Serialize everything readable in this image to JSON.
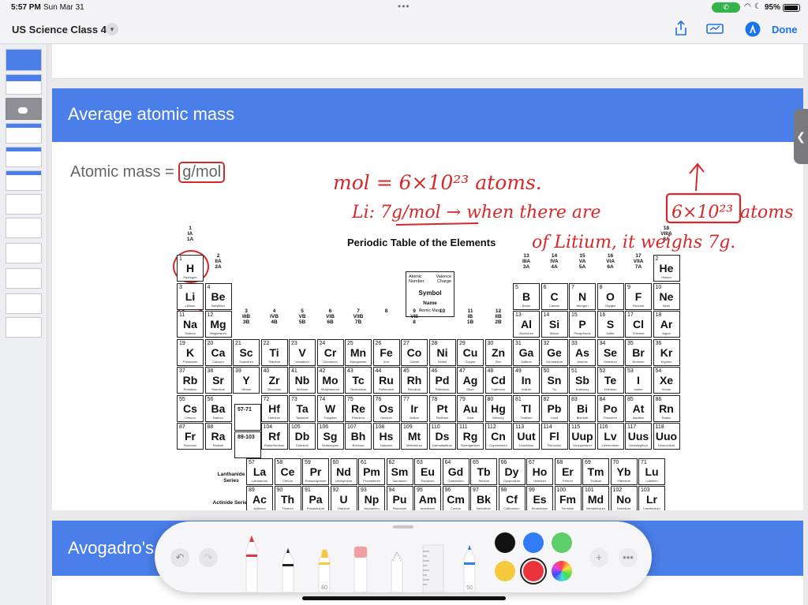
{
  "status": {
    "time": "5:57 PM",
    "date": "Sun Mar 31",
    "battery": "95%"
  },
  "toolbar": {
    "doc_title": "US Science Class 4",
    "done_label": "Done",
    "icons": [
      "share-icon",
      "slideshow-icon",
      "markup-pen-icon"
    ]
  },
  "slide": {
    "title": "Average atomic mass",
    "subtitle_prefix": "Atomic mass = ",
    "subtitle_unit": "g/mol",
    "handwriting": {
      "line1": "mol = 6×10²³ atoms.",
      "line2a": "Li: 7g/mol → when there are",
      "line2b": "6×10²³",
      "line2c": "atoms",
      "line3": "of Litium, it weighs 7g."
    }
  },
  "slide2": {
    "title": "Avogadro's"
  },
  "ptable": {
    "title": "Periodic Table of the Elements",
    "legend": {
      "atomic_number": "Atomic Number",
      "valence": "Valence Charge",
      "symbol": "Symbol",
      "name": "Name",
      "mass": "Atomic   Mass"
    },
    "lanthanide_label": "Lanthanide Series",
    "actinide_label": "Actinide Series",
    "ph_57_71": "57-71",
    "ph_89_103": "89-103",
    "groups": [
      "1 IA 1A",
      "2 IIA 2A",
      "3 IIIB 3B",
      "4 IVB 4B",
      "5 VB 5B",
      "6 VIB 6B",
      "7 VIIB 7B",
      "8",
      "9 VIII 8",
      "10",
      "11 IB 1B",
      "12 IIB 2B",
      "13 IIIA 3A",
      "14 IVA 4A",
      "15 VA 5A",
      "16 VIA 6A",
      "17 VIIA 7A",
      "18 VIIIA 8A"
    ],
    "elements": [
      {
        "n": 1,
        "s": "H",
        "name": "Hydrogen",
        "r": 0,
        "c": 0
      },
      {
        "n": 2,
        "s": "He",
        "name": "Helium",
        "r": 0,
        "c": 17
      },
      {
        "n": 3,
        "s": "Li",
        "name": "Lithium",
        "r": 1,
        "c": 0
      },
      {
        "n": 4,
        "s": "Be",
        "name": "Beryllium",
        "r": 1,
        "c": 1
      },
      {
        "n": 5,
        "s": "B",
        "name": "Boron",
        "r": 1,
        "c": 12
      },
      {
        "n": 6,
        "s": "C",
        "name": "Carbon",
        "r": 1,
        "c": 13
      },
      {
        "n": 7,
        "s": "N",
        "name": "Nitrogen",
        "r": 1,
        "c": 14
      },
      {
        "n": 8,
        "s": "O",
        "name": "Oxygen",
        "r": 1,
        "c": 15
      },
      {
        "n": 9,
        "s": "F",
        "name": "Fluorine",
        "r": 1,
        "c": 16
      },
      {
        "n": 10,
        "s": "Ne",
        "name": "Neon",
        "r": 1,
        "c": 17
      },
      {
        "n": 11,
        "s": "Na",
        "name": "Sodium",
        "r": 2,
        "c": 0
      },
      {
        "n": 12,
        "s": "Mg",
        "name": "Magnesium",
        "r": 2,
        "c": 1
      },
      {
        "n": 13,
        "s": "Al",
        "name": "Aluminum",
        "r": 2,
        "c": 12
      },
      {
        "n": 14,
        "s": "Si",
        "name": "Silicon",
        "r": 2,
        "c": 13
      },
      {
        "n": 15,
        "s": "P",
        "name": "Phosphorus",
        "r": 2,
        "c": 14
      },
      {
        "n": 16,
        "s": "S",
        "name": "Sulfur",
        "r": 2,
        "c": 15
      },
      {
        "n": 17,
        "s": "Cl",
        "name": "Chlorine",
        "r": 2,
        "c": 16
      },
      {
        "n": 18,
        "s": "Ar",
        "name": "Argon",
        "r": 2,
        "c": 17
      },
      {
        "n": 19,
        "s": "K",
        "name": "Potassium",
        "r": 3,
        "c": 0
      },
      {
        "n": 20,
        "s": "Ca",
        "name": "Calcium",
        "r": 3,
        "c": 1
      },
      {
        "n": 21,
        "s": "Sc",
        "name": "Scandium",
        "r": 3,
        "c": 2
      },
      {
        "n": 22,
        "s": "Ti",
        "name": "Titanium",
        "r": 3,
        "c": 3
      },
      {
        "n": 23,
        "s": "V",
        "name": "Vanadium",
        "r": 3,
        "c": 4
      },
      {
        "n": 24,
        "s": "Cr",
        "name": "Chromium",
        "r": 3,
        "c": 5
      },
      {
        "n": 25,
        "s": "Mn",
        "name": "Manganese",
        "r": 3,
        "c": 6
      },
      {
        "n": 26,
        "s": "Fe",
        "name": "Iron",
        "r": 3,
        "c": 7
      },
      {
        "n": 27,
        "s": "Co",
        "name": "Cobalt",
        "r": 3,
        "c": 8
      },
      {
        "n": 28,
        "s": "Ni",
        "name": "Nickel",
        "r": 3,
        "c": 9
      },
      {
        "n": 29,
        "s": "Cu",
        "name": "Copper",
        "r": 3,
        "c": 10
      },
      {
        "n": 30,
        "s": "Zn",
        "name": "Zinc",
        "r": 3,
        "c": 11
      },
      {
        "n": 31,
        "s": "Ga",
        "name": "Gallium",
        "r": 3,
        "c": 12
      },
      {
        "n": 32,
        "s": "Ge",
        "name": "Germanium",
        "r": 3,
        "c": 13
      },
      {
        "n": 33,
        "s": "As",
        "name": "Arsenic",
        "r": 3,
        "c": 14
      },
      {
        "n": 34,
        "s": "Se",
        "name": "Selenium",
        "r": 3,
        "c": 15
      },
      {
        "n": 35,
        "s": "Br",
        "name": "Bromine",
        "r": 3,
        "c": 16
      },
      {
        "n": 36,
        "s": "Kr",
        "name": "Krypton",
        "r": 3,
        "c": 17
      },
      {
        "n": 37,
        "s": "Rb",
        "name": "Rubidium",
        "r": 4,
        "c": 0
      },
      {
        "n": 38,
        "s": "Sr",
        "name": "Strontium",
        "r": 4,
        "c": 1
      },
      {
        "n": 39,
        "s": "Y",
        "name": "Yttrium",
        "r": 4,
        "c": 2
      },
      {
        "n": 40,
        "s": "Zr",
        "name": "Zirconium",
        "r": 4,
        "c": 3
      },
      {
        "n": 41,
        "s": "Nb",
        "name": "Niobium",
        "r": 4,
        "c": 4
      },
      {
        "n": 42,
        "s": "Mo",
        "name": "Molybdenum",
        "r": 4,
        "c": 5
      },
      {
        "n": 43,
        "s": "Tc",
        "name": "Technetium",
        "r": 4,
        "c": 6
      },
      {
        "n": 44,
        "s": "Ru",
        "name": "Ruthenium",
        "r": 4,
        "c": 7
      },
      {
        "n": 45,
        "s": "Rh",
        "name": "Rhodium",
        "r": 4,
        "c": 8
      },
      {
        "n": 46,
        "s": "Pd",
        "name": "Palladium",
        "r": 4,
        "c": 9
      },
      {
        "n": 47,
        "s": "Ag",
        "name": "Silver",
        "r": 4,
        "c": 10
      },
      {
        "n": 48,
        "s": "Cd",
        "name": "Cadmium",
        "r": 4,
        "c": 11
      },
      {
        "n": 49,
        "s": "In",
        "name": "Indium",
        "r": 4,
        "c": 12
      },
      {
        "n": 50,
        "s": "Sn",
        "name": "Tin",
        "r": 4,
        "c": 13
      },
      {
        "n": 51,
        "s": "Sb",
        "name": "Antimony",
        "r": 4,
        "c": 14
      },
      {
        "n": 52,
        "s": "Te",
        "name": "Tellurium",
        "r": 4,
        "c": 15
      },
      {
        "n": 53,
        "s": "I",
        "name": "Iodine",
        "r": 4,
        "c": 16
      },
      {
        "n": 54,
        "s": "Xe",
        "name": "Xenon",
        "r": 4,
        "c": 17
      },
      {
        "n": 55,
        "s": "Cs",
        "name": "Cesium",
        "r": 5,
        "c": 0
      },
      {
        "n": 56,
        "s": "Ba",
        "name": "Barium",
        "r": 5,
        "c": 1
      },
      {
        "n": 72,
        "s": "Hf",
        "name": "Hafnium",
        "r": 5,
        "c": 3
      },
      {
        "n": 73,
        "s": "Ta",
        "name": "Tantalum",
        "r": 5,
        "c": 4
      },
      {
        "n": 74,
        "s": "W",
        "name": "Tungsten",
        "r": 5,
        "c": 5
      },
      {
        "n": 75,
        "s": "Re",
        "name": "Rhenium",
        "r": 5,
        "c": 6
      },
      {
        "n": 76,
        "s": "Os",
        "name": "Osmium",
        "r": 5,
        "c": 7
      },
      {
        "n": 77,
        "s": "Ir",
        "name": "Iridium",
        "r": 5,
        "c": 8
      },
      {
        "n": 78,
        "s": "Pt",
        "name": "Platinum",
        "r": 5,
        "c": 9
      },
      {
        "n": 79,
        "s": "Au",
        "name": "Gold",
        "r": 5,
        "c": 10
      },
      {
        "n": 80,
        "s": "Hg",
        "name": "Mercury",
        "r": 5,
        "c": 11
      },
      {
        "n": 81,
        "s": "Tl",
        "name": "Thallium",
        "r": 5,
        "c": 12
      },
      {
        "n": 82,
        "s": "Pb",
        "name": "Lead",
        "r": 5,
        "c": 13
      },
      {
        "n": 83,
        "s": "Bi",
        "name": "Bismuth",
        "r": 5,
        "c": 14
      },
      {
        "n": 84,
        "s": "Po",
        "name": "Polonium",
        "r": 5,
        "c": 15
      },
      {
        "n": 85,
        "s": "At",
        "name": "Astatine",
        "r": 5,
        "c": 16
      },
      {
        "n": 86,
        "s": "Rn",
        "name": "Radon",
        "r": 5,
        "c": 17
      },
      {
        "n": 87,
        "s": "Fr",
        "name": "Francium",
        "r": 6,
        "c": 0
      },
      {
        "n": 88,
        "s": "Ra",
        "name": "Radium",
        "r": 6,
        "c": 1
      },
      {
        "n": 104,
        "s": "Rf",
        "name": "Rutherfordium",
        "r": 6,
        "c": 3
      },
      {
        "n": 105,
        "s": "Db",
        "name": "Dubnium",
        "r": 6,
        "c": 4
      },
      {
        "n": 106,
        "s": "Sg",
        "name": "Seaborgium",
        "r": 6,
        "c": 5
      },
      {
        "n": 107,
        "s": "Bh",
        "name": "Bohrium",
        "r": 6,
        "c": 6
      },
      {
        "n": 108,
        "s": "Hs",
        "name": "Hassium",
        "r": 6,
        "c": 7
      },
      {
        "n": 109,
        "s": "Mt",
        "name": "Meitnerium",
        "r": 6,
        "c": 8
      },
      {
        "n": 110,
        "s": "Ds",
        "name": "Darmstadtium",
        "r": 6,
        "c": 9
      },
      {
        "n": 111,
        "s": "Rg",
        "name": "Roentgenium",
        "r": 6,
        "c": 10
      },
      {
        "n": 112,
        "s": "Cn",
        "name": "Copernicium",
        "r": 6,
        "c": 11
      },
      {
        "n": 113,
        "s": "Uut",
        "name": "Ununtrium",
        "r": 6,
        "c": 12
      },
      {
        "n": 114,
        "s": "Fl",
        "name": "Flerovium",
        "r": 6,
        "c": 13
      },
      {
        "n": 115,
        "s": "Uup",
        "name": "Ununpentium",
        "r": 6,
        "c": 14
      },
      {
        "n": 116,
        "s": "Lv",
        "name": "Livermorium",
        "r": 6,
        "c": 15
      },
      {
        "n": 117,
        "s": "Uus",
        "name": "Ununseptium",
        "r": 6,
        "c": 16
      },
      {
        "n": 118,
        "s": "Uuo",
        "name": "Ununoctium",
        "r": 6,
        "c": 17
      }
    ],
    "lanthanides": [
      {
        "n": 57,
        "s": "La",
        "name": "Lanthanum"
      },
      {
        "n": 58,
        "s": "Ce",
        "name": "Cerium"
      },
      {
        "n": 59,
        "s": "Pr",
        "name": "Praseodymium"
      },
      {
        "n": 60,
        "s": "Nd",
        "name": "Neodymium"
      },
      {
        "n": 61,
        "s": "Pm",
        "name": "Promethium"
      },
      {
        "n": 62,
        "s": "Sm",
        "name": "Samarium"
      },
      {
        "n": 63,
        "s": "Eu",
        "name": "Europium"
      },
      {
        "n": 64,
        "s": "Gd",
        "name": "Gadolinium"
      },
      {
        "n": 65,
        "s": "Tb",
        "name": "Terbium"
      },
      {
        "n": 66,
        "s": "Dy",
        "name": "Dysprosium"
      },
      {
        "n": 67,
        "s": "Ho",
        "name": "Holmium"
      },
      {
        "n": 68,
        "s": "Er",
        "name": "Erbium"
      },
      {
        "n": 69,
        "s": "Tm",
        "name": "Thulium"
      },
      {
        "n": 70,
        "s": "Yb",
        "name": "Ytterbium"
      },
      {
        "n": 71,
        "s": "Lu",
        "name": "Lutetium"
      }
    ],
    "actinides": [
      {
        "n": 89,
        "s": "Ac",
        "name": "Actinium"
      },
      {
        "n": 90,
        "s": "Th",
        "name": "Thorium"
      },
      {
        "n": 91,
        "s": "Pa",
        "name": "Protactinium"
      },
      {
        "n": 92,
        "s": "U",
        "name": "Uranium"
      },
      {
        "n": 93,
        "s": "Np",
        "name": "Neptunium"
      },
      {
        "n": 94,
        "s": "Pu",
        "name": "Plutonium"
      },
      {
        "n": 95,
        "s": "Am",
        "name": "Americium"
      },
      {
        "n": 96,
        "s": "Cm",
        "name": "Curium"
      },
      {
        "n": 97,
        "s": "Bk",
        "name": "Berkelium"
      },
      {
        "n": 98,
        "s": "Cf",
        "name": "Californium"
      },
      {
        "n": 99,
        "s": "Es",
        "name": "Einsteinium"
      },
      {
        "n": 100,
        "s": "Fm",
        "name": "Fermium"
      },
      {
        "n": 101,
        "s": "Md",
        "name": "Mendelevium"
      },
      {
        "n": 102,
        "s": "No",
        "name": "Nobelium"
      },
      {
        "n": 103,
        "s": "Lr",
        "name": "Lawrencium"
      }
    ]
  },
  "markup": {
    "highlighter_label": "80",
    "pencil_label": "50",
    "colors": [
      "#111111",
      "#2f7cf6",
      "#5fcf6a",
      "#f5c93b",
      "#e8343a"
    ],
    "selected_color": "#e8343a"
  }
}
